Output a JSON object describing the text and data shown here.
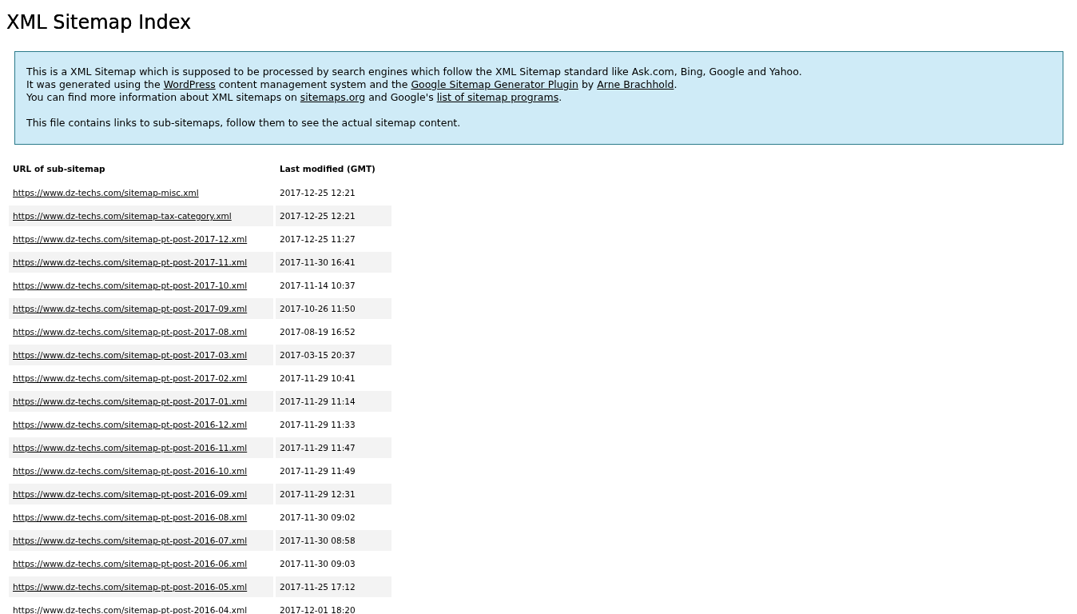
{
  "title": "XML Sitemap Index",
  "intro": {
    "lines": [
      [
        {
          "text": "This is a XML Sitemap which is supposed to be processed by search engines which follow the XML Sitemap standard like Ask.com, Bing, Google and Yahoo.",
          "link": false
        }
      ],
      [
        {
          "text": "It was generated using the ",
          "link": false
        },
        {
          "text": "WordPress",
          "link": true
        },
        {
          "text": " content management system and the ",
          "link": false
        },
        {
          "text": "Google Sitemap Generator Plugin",
          "link": true
        },
        {
          "text": " by ",
          "link": false
        },
        {
          "text": "Arne Brachhold",
          "link": true
        },
        {
          "text": ".",
          "link": false
        }
      ],
      [
        {
          "text": "You can find more information about XML sitemaps on ",
          "link": false
        },
        {
          "text": "sitemaps.org",
          "link": true
        },
        {
          "text": " and Google's ",
          "link": false
        },
        {
          "text": "list of sitemap programs",
          "link": true
        },
        {
          "text": ".",
          "link": false
        }
      ]
    ],
    "note": "This file contains links to sub-sitemaps, follow them to see the actual sitemap content."
  },
  "table": {
    "columns": [
      "URL of sub-sitemap",
      "Last modified (GMT)"
    ],
    "rows": [
      {
        "url": "https://www.dz-techs.com/sitemap-misc.xml",
        "modified": "2017-12-25 12:21"
      },
      {
        "url": "https://www.dz-techs.com/sitemap-tax-category.xml",
        "modified": "2017-12-25 12:21"
      },
      {
        "url": "https://www.dz-techs.com/sitemap-pt-post-2017-12.xml",
        "modified": "2017-12-25 11:27"
      },
      {
        "url": "https://www.dz-techs.com/sitemap-pt-post-2017-11.xml",
        "modified": "2017-11-30 16:41"
      },
      {
        "url": "https://www.dz-techs.com/sitemap-pt-post-2017-10.xml",
        "modified": "2017-11-14 10:37"
      },
      {
        "url": "https://www.dz-techs.com/sitemap-pt-post-2017-09.xml",
        "modified": "2017-10-26 11:50"
      },
      {
        "url": "https://www.dz-techs.com/sitemap-pt-post-2017-08.xml",
        "modified": "2017-08-19 16:52"
      },
      {
        "url": "https://www.dz-techs.com/sitemap-pt-post-2017-03.xml",
        "modified": "2017-03-15 20:37"
      },
      {
        "url": "https://www.dz-techs.com/sitemap-pt-post-2017-02.xml",
        "modified": "2017-11-29 10:41"
      },
      {
        "url": "https://www.dz-techs.com/sitemap-pt-post-2017-01.xml",
        "modified": "2017-11-29 11:14"
      },
      {
        "url": "https://www.dz-techs.com/sitemap-pt-post-2016-12.xml",
        "modified": "2017-11-29 11:33"
      },
      {
        "url": "https://www.dz-techs.com/sitemap-pt-post-2016-11.xml",
        "modified": "2017-11-29 11:47"
      },
      {
        "url": "https://www.dz-techs.com/sitemap-pt-post-2016-10.xml",
        "modified": "2017-11-29 11:49"
      },
      {
        "url": "https://www.dz-techs.com/sitemap-pt-post-2016-09.xml",
        "modified": "2017-11-29 12:31"
      },
      {
        "url": "https://www.dz-techs.com/sitemap-pt-post-2016-08.xml",
        "modified": "2017-11-30 09:02"
      },
      {
        "url": "https://www.dz-techs.com/sitemap-pt-post-2016-07.xml",
        "modified": "2017-11-30 08:58"
      },
      {
        "url": "https://www.dz-techs.com/sitemap-pt-post-2016-06.xml",
        "modified": "2017-11-30 09:03"
      },
      {
        "url": "https://www.dz-techs.com/sitemap-pt-post-2016-05.xml",
        "modified": "2017-11-25 17:12"
      },
      {
        "url": "https://www.dz-techs.com/sitemap-pt-post-2016-04.xml",
        "modified": "2017-12-01 18:20"
      }
    ]
  }
}
